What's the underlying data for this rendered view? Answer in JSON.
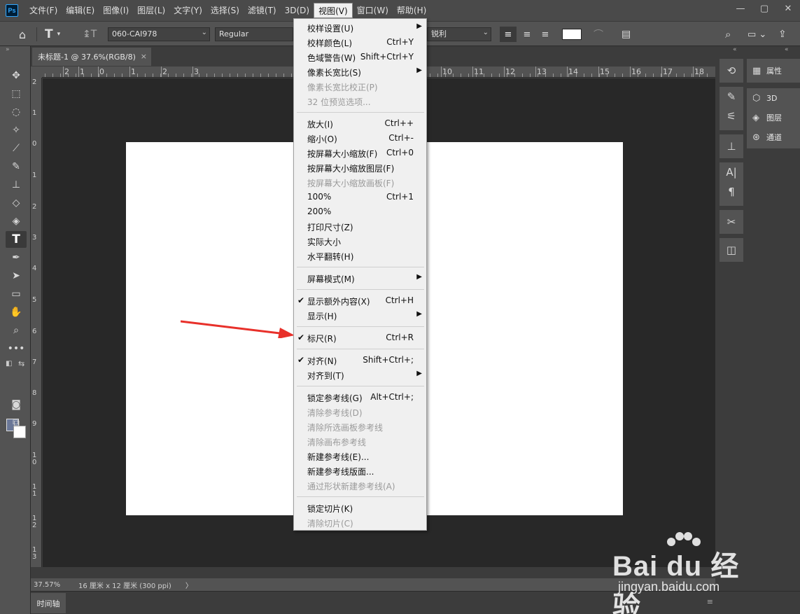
{
  "app": {
    "logo": "Ps"
  },
  "menubar": {
    "items": [
      "文件(F)",
      "编辑(E)",
      "图像(I)",
      "图层(L)",
      "文字(Y)",
      "选择(S)",
      "滤镜(T)",
      "3D(D)",
      "视图(V)",
      "窗口(W)",
      "帮助(H)"
    ],
    "active_index": 8
  },
  "window_controls": {
    "minimize": "—",
    "restore": "▢",
    "close": "✕"
  },
  "options": {
    "font_family": "060-CAI978",
    "font_style": "Regular",
    "antialias": "锐利",
    "text_color": "#ffffff"
  },
  "document": {
    "tab_title": "未标题-1 @ 37.6%(RGB/8)",
    "close": "×"
  },
  "ruler_top": [
    "2",
    "1",
    "0",
    "1",
    "2",
    "3",
    "10",
    "11",
    "12",
    "13",
    "14",
    "15",
    "16",
    "17",
    "18"
  ],
  "ruler_left": [
    "2",
    "1",
    "0",
    "1",
    "2",
    "3",
    "4",
    "5",
    "6",
    "7",
    "8",
    "9",
    "10",
    "11",
    "12",
    "13"
  ],
  "status": {
    "zoom": "37.57%",
    "doc_info": "16 厘米 x 12 厘米 (300 ppi)",
    "arrow": "〉"
  },
  "timeline": {
    "label": "时间轴"
  },
  "right_panel": {
    "items": [
      {
        "icon": "properties-icon",
        "label": "属性"
      },
      {
        "icon": "cube-icon",
        "label": "3D"
      },
      {
        "icon": "layers-icon",
        "label": "图层"
      },
      {
        "icon": "channels-icon",
        "label": "通道"
      }
    ]
  },
  "view_menu": {
    "items": [
      {
        "label": "校样设置(U)",
        "shortcut": "",
        "submenu": true,
        "disabled": false,
        "checked": false
      },
      {
        "label": "校样颜色(L)",
        "shortcut": "Ctrl+Y",
        "submenu": false,
        "disabled": false,
        "checked": false
      },
      {
        "label": "色域警告(W)",
        "shortcut": "Shift+Ctrl+Y",
        "submenu": false,
        "disabled": false,
        "checked": false
      },
      {
        "label": "像素长宽比(S)",
        "shortcut": "",
        "submenu": true,
        "disabled": false,
        "checked": false
      },
      {
        "label": "像素长宽比校正(P)",
        "shortcut": "",
        "submenu": false,
        "disabled": true,
        "checked": false
      },
      {
        "label": "32 位预览选项...",
        "shortcut": "",
        "submenu": false,
        "disabled": true,
        "checked": false
      },
      {
        "label": "放大(I)",
        "shortcut": "Ctrl++",
        "submenu": false,
        "disabled": false,
        "checked": false
      },
      {
        "label": "缩小(O)",
        "shortcut": "Ctrl+-",
        "submenu": false,
        "disabled": false,
        "checked": false
      },
      {
        "label": "按屏幕大小缩放(F)",
        "shortcut": "Ctrl+0",
        "submenu": false,
        "disabled": false,
        "checked": false
      },
      {
        "label": "按屏幕大小缩放图层(F)",
        "shortcut": "",
        "submenu": false,
        "disabled": false,
        "checked": false
      },
      {
        "label": "按屏幕大小缩放画板(F)",
        "shortcut": "",
        "submenu": false,
        "disabled": true,
        "checked": false
      },
      {
        "label": "100%",
        "shortcut": "Ctrl+1",
        "submenu": false,
        "disabled": false,
        "checked": false
      },
      {
        "label": "200%",
        "shortcut": "",
        "submenu": false,
        "disabled": false,
        "checked": false
      },
      {
        "label": "打印尺寸(Z)",
        "shortcut": "",
        "submenu": false,
        "disabled": false,
        "checked": false
      },
      {
        "label": "实际大小",
        "shortcut": "",
        "submenu": false,
        "disabled": false,
        "checked": false
      },
      {
        "label": "水平翻转(H)",
        "shortcut": "",
        "submenu": false,
        "disabled": false,
        "checked": false
      },
      {
        "label": "屏幕模式(M)",
        "shortcut": "",
        "submenu": true,
        "disabled": false,
        "checked": false
      },
      {
        "label": "显示额外内容(X)",
        "shortcut": "Ctrl+H",
        "submenu": false,
        "disabled": false,
        "checked": true
      },
      {
        "label": "显示(H)",
        "shortcut": "",
        "submenu": true,
        "disabled": false,
        "checked": false
      },
      {
        "label": "标尺(R)",
        "shortcut": "Ctrl+R",
        "submenu": false,
        "disabled": false,
        "checked": true
      },
      {
        "label": "对齐(N)",
        "shortcut": "Shift+Ctrl+;",
        "submenu": false,
        "disabled": false,
        "checked": true
      },
      {
        "label": "对齐到(T)",
        "shortcut": "",
        "submenu": true,
        "disabled": false,
        "checked": false
      },
      {
        "label": "锁定参考线(G)",
        "shortcut": "Alt+Ctrl+;",
        "submenu": false,
        "disabled": false,
        "checked": false
      },
      {
        "label": "清除参考线(D)",
        "shortcut": "",
        "submenu": false,
        "disabled": true,
        "checked": false
      },
      {
        "label": "清除所选画板参考线",
        "shortcut": "",
        "submenu": false,
        "disabled": true,
        "checked": false
      },
      {
        "label": "清除画布参考线",
        "shortcut": "",
        "submenu": false,
        "disabled": true,
        "checked": false
      },
      {
        "label": "新建参考线(E)...",
        "shortcut": "",
        "submenu": false,
        "disabled": false,
        "checked": false
      },
      {
        "label": "新建参考线版面...",
        "shortcut": "",
        "submenu": false,
        "disabled": false,
        "checked": false
      },
      {
        "label": "通过形状新建参考线(A)",
        "shortcut": "",
        "submenu": false,
        "disabled": true,
        "checked": false
      },
      {
        "label": "锁定切片(K)",
        "shortcut": "",
        "submenu": false,
        "disabled": false,
        "checked": false
      },
      {
        "label": "清除切片(C)",
        "shortcut": "",
        "submenu": false,
        "disabled": true,
        "checked": false
      }
    ]
  },
  "watermark": {
    "brand": "Bai du 经验",
    "url": "jingyan.baidu.com"
  },
  "colors": {
    "accent_arrow": "#e8302a",
    "foreground_swatch": "#6a7797",
    "background_swatch": "#ffffff"
  }
}
